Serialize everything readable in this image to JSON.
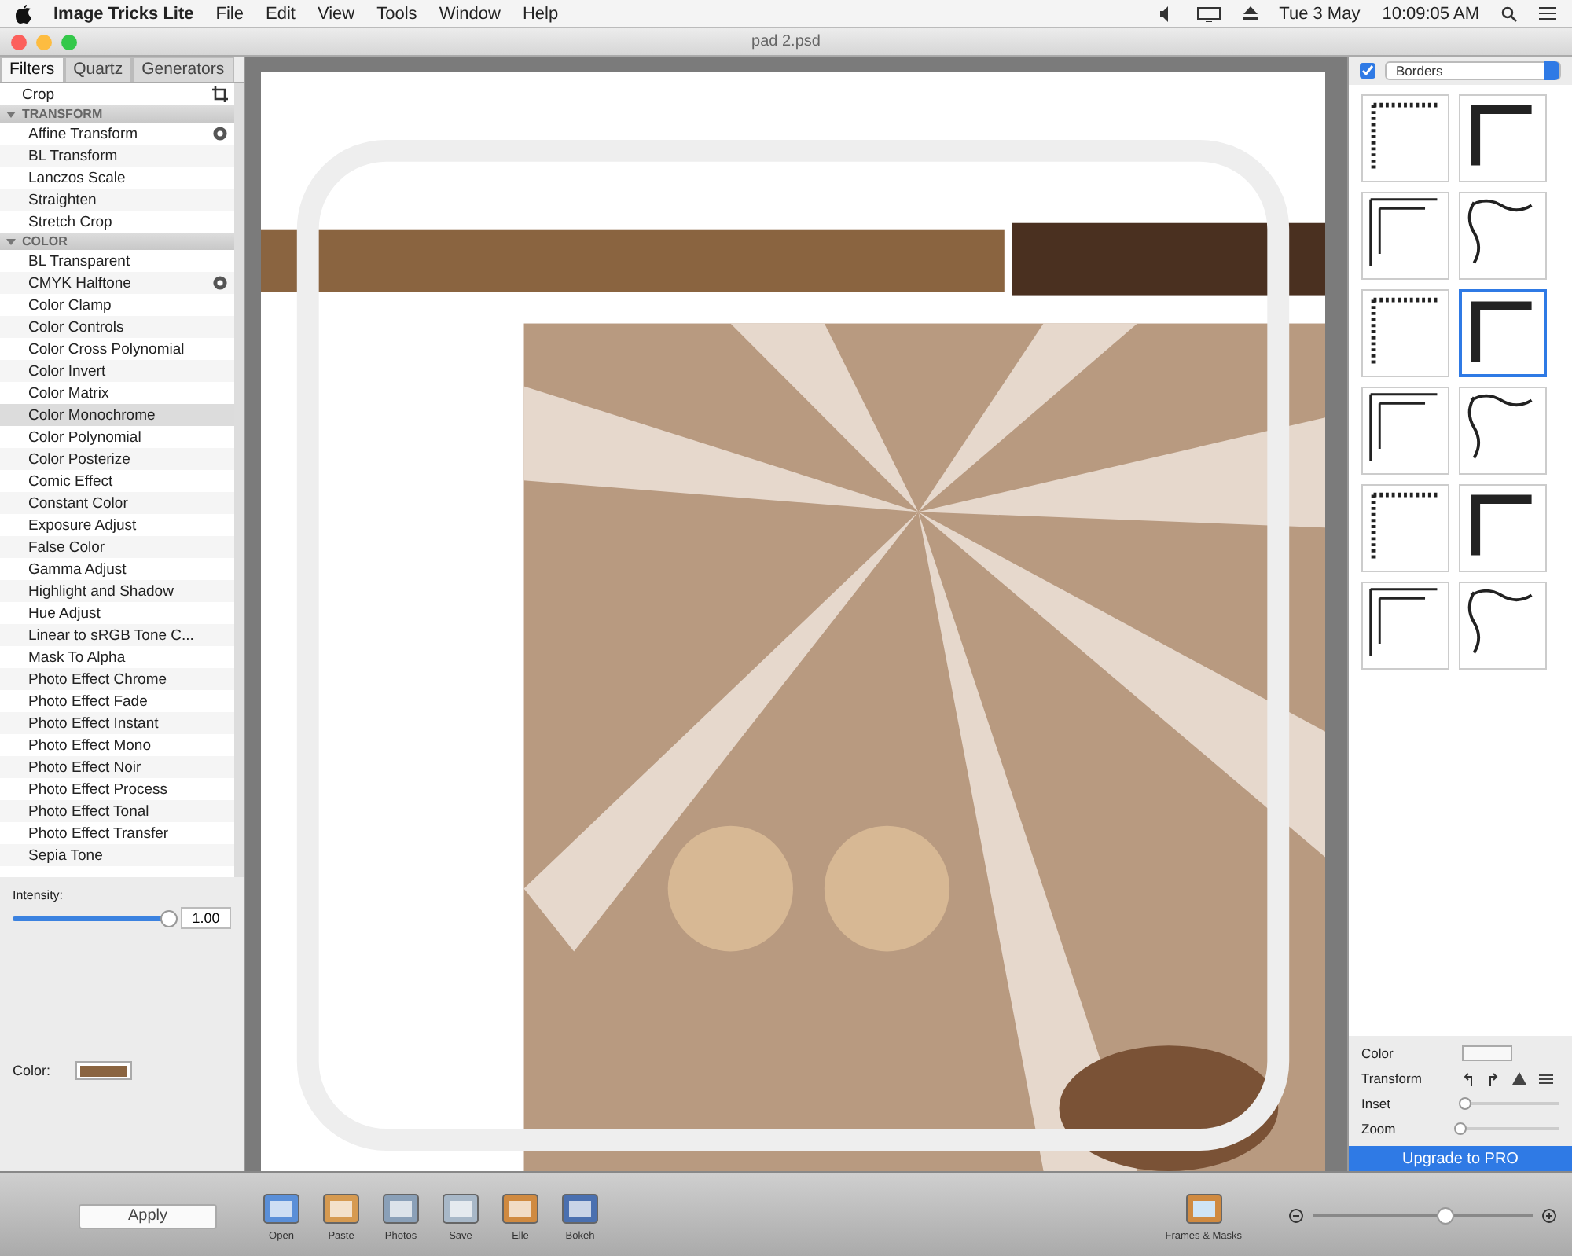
{
  "menu_bar": {
    "app_name": "Image Tricks Lite",
    "menus": [
      "File",
      "Edit",
      "View",
      "Tools",
      "Window",
      "Help"
    ],
    "date": "Tue 3 May",
    "time": "10:09:05 AM"
  },
  "window": {
    "title": "pad 2.psd"
  },
  "tabs": [
    {
      "label": "Filters",
      "selected": true
    },
    {
      "label": "Quartz",
      "selected": false
    },
    {
      "label": "Generators",
      "selected": false
    }
  ],
  "filter_list": [
    {
      "kind": "crop",
      "label": "Crop",
      "selected": false
    },
    {
      "kind": "header",
      "label": "TRANSFORM",
      "expanded": true,
      "children": [
        {
          "kind": "options",
          "label": "Affine Transform",
          "selected": false
        },
        {
          "label": "BL Transform",
          "selected": false
        },
        {
          "label": "Lanczos Scale",
          "selected": false
        },
        {
          "label": "Straighten",
          "selected": false
        },
        {
          "label": "Stretch Crop",
          "selected": false
        }
      ]
    },
    {
      "kind": "header",
      "label": "COLOR",
      "expanded": true,
      "children": [
        {
          "label": "BL Transparent",
          "selected": false
        },
        {
          "kind": "options",
          "label": "CMYK Halftone",
          "selected": false
        },
        {
          "label": "Color Clamp",
          "selected": false
        },
        {
          "label": "Color Controls",
          "selected": false
        },
        {
          "label": "Color Cross Polynomial",
          "selected": false
        },
        {
          "label": "Color Invert",
          "selected": false
        },
        {
          "label": "Color Matrix",
          "selected": false
        },
        {
          "label": "Color Monochrome",
          "selected": true
        },
        {
          "label": "Color Polynomial",
          "selected": false
        },
        {
          "label": "Color Posterize",
          "selected": false
        },
        {
          "label": "Comic Effect",
          "selected": false
        },
        {
          "label": "Constant Color",
          "selected": false
        },
        {
          "label": "Exposure Adjust",
          "selected": false
        },
        {
          "label": "False Color",
          "selected": false
        },
        {
          "label": "Gamma Adjust",
          "selected": false
        },
        {
          "label": "Highlight and Shadow",
          "selected": false
        },
        {
          "label": "Hue Adjust",
          "selected": false
        },
        {
          "label": "Linear to sRGB Tone C...",
          "selected": false
        },
        {
          "label": "Mask To Alpha",
          "selected": false
        },
        {
          "label": "Photo Effect Chrome",
          "selected": false
        },
        {
          "label": "Photo Effect Fade",
          "selected": false
        },
        {
          "label": "Photo Effect Instant",
          "selected": false
        },
        {
          "label": "Photo Effect Mono",
          "selected": false
        },
        {
          "label": "Photo Effect Noir",
          "selected": false
        },
        {
          "label": "Photo Effect Process",
          "selected": false
        },
        {
          "label": "Photo Effect Tonal",
          "selected": false
        },
        {
          "label": "Photo Effect Transfer",
          "selected": false
        },
        {
          "label": "Sepia Tone",
          "selected": false
        }
      ]
    }
  ],
  "intensity": {
    "label": "Intensity:",
    "level": 0.98,
    "value": "1.00"
  },
  "color_param": {
    "label": "Color:",
    "color": "#8a6440"
  },
  "apply_button": "Apply",
  "borders_panel": {
    "enabled": true,
    "category": "Borders",
    "thumbnails": [
      {
        "selected": false
      },
      {
        "selected": false
      },
      {
        "selected": false
      },
      {
        "selected": false
      },
      {
        "selected": false
      },
      {
        "selected": true
      },
      {
        "selected": false
      },
      {
        "selected": false
      },
      {
        "selected": false
      },
      {
        "selected": false
      },
      {
        "selected": false
      },
      {
        "selected": false
      }
    ]
  },
  "border_settings": {
    "color_label": "Color",
    "transform_label": "Transform",
    "inset": {
      "label": "Inset",
      "level": 0.05
    },
    "zoom": {
      "label": "Zoom",
      "level": 0.0
    }
  },
  "upgrade_button": "Upgrade to PRO",
  "toolbar": [
    {
      "label": "Open"
    },
    {
      "label": "Paste"
    },
    {
      "label": "Photos"
    },
    {
      "label": "Save"
    },
    {
      "label": "Elle"
    },
    {
      "label": "Bokeh"
    }
  ],
  "frames_button": "Frames & Masks",
  "zoom_slider": {
    "level": 0.6
  }
}
